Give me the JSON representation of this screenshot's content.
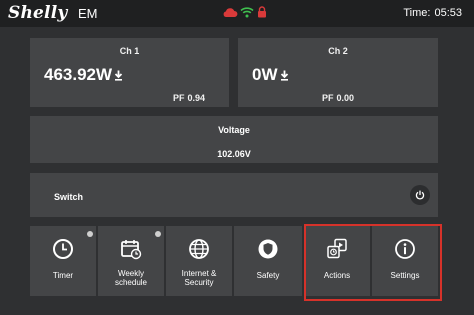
{
  "header": {
    "logo_text": "Shelly",
    "model": "EM",
    "time_label": "Time:",
    "time_value": "05:53",
    "icons": [
      "cloud-icon",
      "wifi-icon",
      "lock-icon"
    ],
    "colors": {
      "cloud": "#d93a3a",
      "wifi": "#3fbf4f",
      "lock": "#d93a3a"
    }
  },
  "channels": [
    {
      "title": "Ch 1",
      "power": "463.92W",
      "pf_label": "PF",
      "pf_value": "0.94"
    },
    {
      "title": "Ch 2",
      "power": "0W",
      "pf_label": "PF",
      "pf_value": "0.00"
    }
  ],
  "voltage": {
    "title": "Voltage",
    "value": "102.06V"
  },
  "switch": {
    "label": "Switch"
  },
  "tiles": [
    {
      "label": "Timer",
      "icon": "clock-icon",
      "has_dot": true
    },
    {
      "label": "Weekly\nschedule",
      "icon": "calendar-icon",
      "has_dot": true
    },
    {
      "label": "Internet &\nSecurity",
      "icon": "globe-icon",
      "has_dot": false
    },
    {
      "label": "Safety",
      "icon": "shield-icon",
      "has_dot": false
    },
    {
      "label": "Actions",
      "icon": "actions-icon",
      "has_dot": false
    },
    {
      "label": "Settings",
      "icon": "info-icon",
      "has_dot": false
    }
  ],
  "highlight_color": "#d6322a"
}
